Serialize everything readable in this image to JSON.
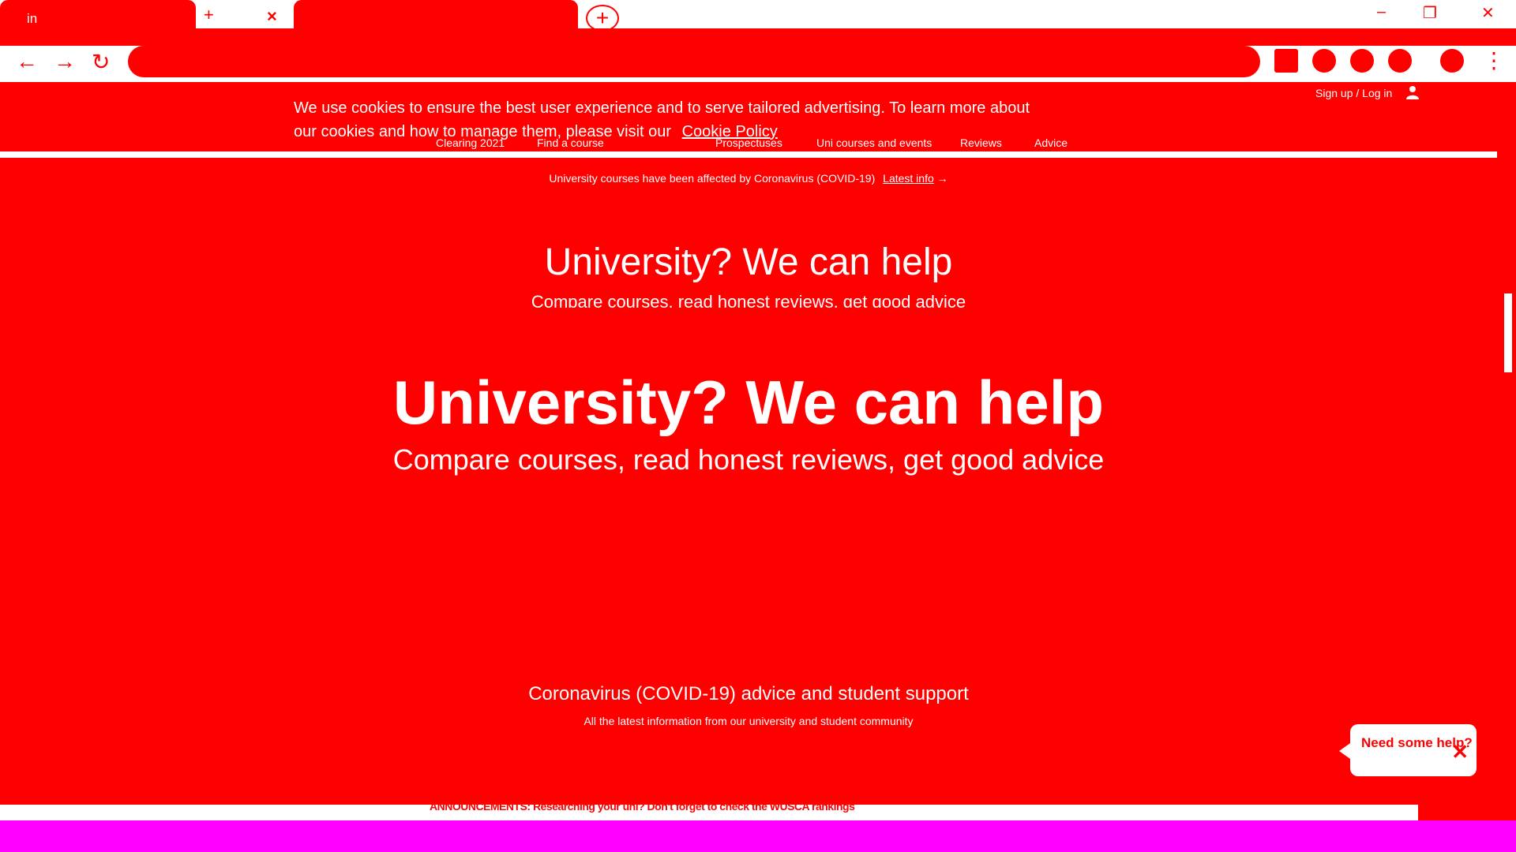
{
  "browser": {
    "tabs": [
      {
        "title": "in"
      },
      {
        "title": ""
      }
    ],
    "new_tab_symbol": "+",
    "tab_close_symbol": "×",
    "controls": {
      "minimize": "–",
      "restore": "❐",
      "close": "✕"
    },
    "nav": {
      "back": "←",
      "forward": "→",
      "reload": "↻"
    },
    "address": "",
    "menu": "⋮"
  },
  "cookie_banner": {
    "text": "We use cookies to ensure the best user experience and to serve tailored advertising. To learn more about our cookies and how to manage them, please visit our",
    "link": "Cookie Policy"
  },
  "header": {
    "signin": "Sign up / Log in"
  },
  "nav": {
    "items": [
      "Clearing 2021",
      "Find a course",
      "",
      "Prospectuses",
      "Uni courses and events",
      "Reviews",
      "Advice"
    ]
  },
  "notice": {
    "text": "University courses have been affected by Coronavirus (COVID-19)",
    "link": "Latest info"
  },
  "hero": {
    "title": "University? We can help",
    "subtitle": "Compare courses, read honest reviews, get good advice"
  },
  "covid": {
    "title": "Coronavirus (COVID-19) advice and student support",
    "subtitle": "All the latest information from our university and student community"
  },
  "help_widget": {
    "text": "Need some help?",
    "close": "✕"
  },
  "announcement": {
    "text": "ANNOUNCEMENTS: Researching your uni? Don't forget to check the WUSCA rankings"
  },
  "colors": {
    "primary": "#ff0000",
    "surface": "#ffffff",
    "taskbar": "#ff00ff"
  }
}
